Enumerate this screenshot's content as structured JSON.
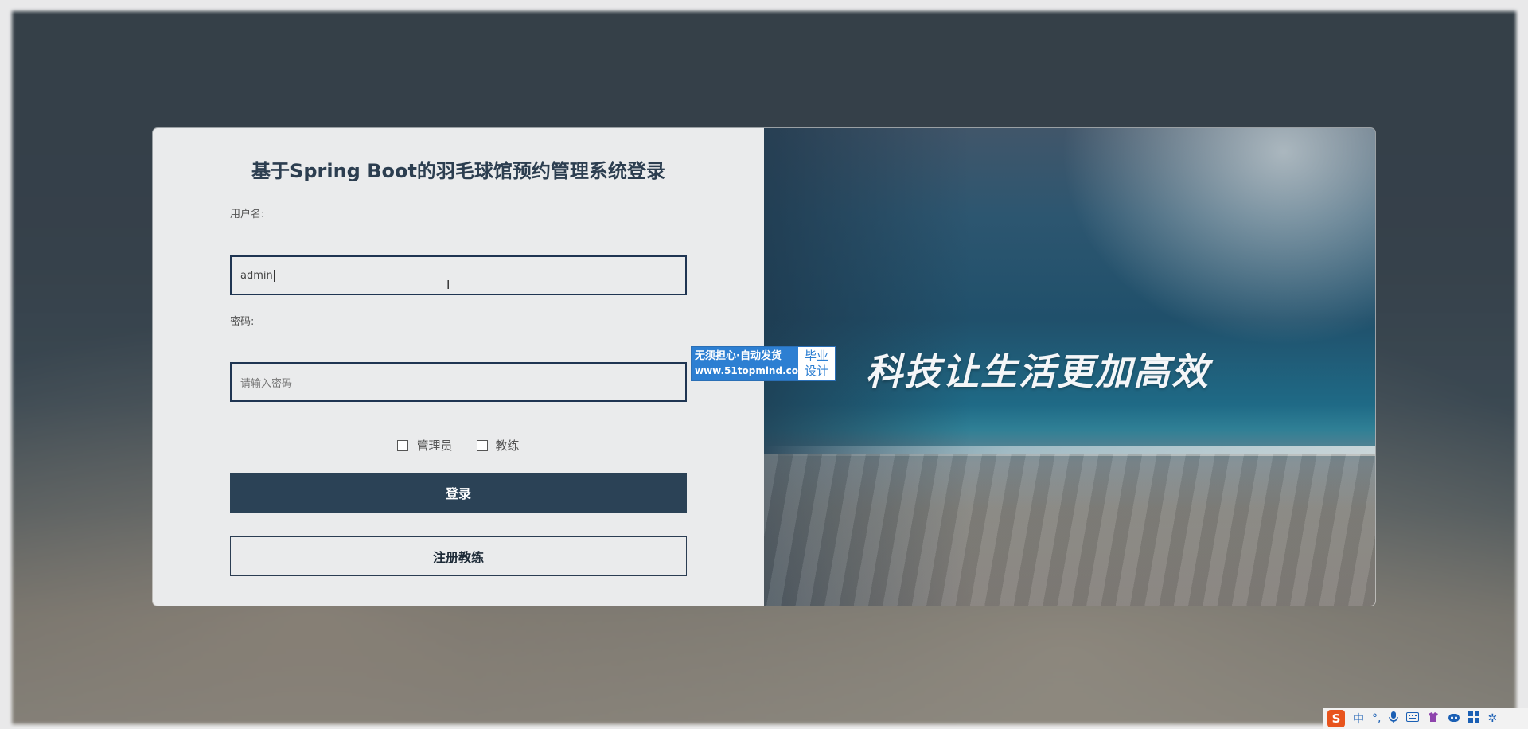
{
  "login": {
    "title": "基于Spring Boot的羽毛球馆预约管理系统登录",
    "username_label": "用户名:",
    "username_value": "admin",
    "password_label": "密码:",
    "password_placeholder": "请输入密码",
    "roles": [
      {
        "label": "管理员",
        "checked": false
      },
      {
        "label": "教练",
        "checked": false
      }
    ],
    "login_button": "登录",
    "register_button": "注册教练"
  },
  "banner": {
    "slogan": "科技让生活更加高效"
  },
  "ad": {
    "line1": "无须担心·自动发货",
    "line2": "www.51topmind.com",
    "right_line1": "毕业",
    "right_line2": "设计"
  },
  "tray": {
    "ime_logo": "S",
    "ime_mode": "中",
    "icons": [
      "punctuation-icon",
      "microphone-icon",
      "keyboard-icon",
      "skin-icon",
      "assistant-icon",
      "grid-icon",
      "settings-icon"
    ]
  },
  "colors": {
    "primary": "#2b4256",
    "input_border": "#1f3552",
    "ad_blue": "#2d7fd2"
  }
}
